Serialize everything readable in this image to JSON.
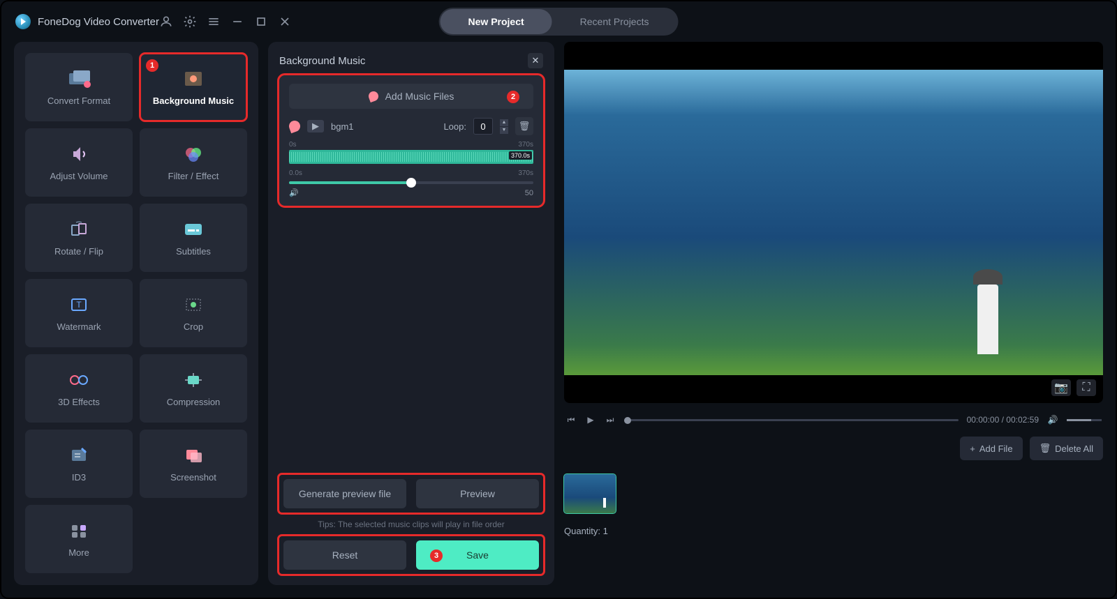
{
  "app": {
    "title": "FoneDog Video Converter"
  },
  "tabs": {
    "new_project": "New Project",
    "recent_projects": "Recent Projects"
  },
  "tools": {
    "convert_format": "Convert Format",
    "background_music": "Background Music",
    "adjust_volume": "Adjust Volume",
    "filter_effect": "Filter / Effect",
    "rotate_flip": "Rotate / Flip",
    "subtitles": "Subtitles",
    "watermark": "Watermark",
    "crop": "Crop",
    "effects_3d": "3D Effects",
    "compression": "Compression",
    "id3": "ID3",
    "screenshot": "Screenshot",
    "more": "More"
  },
  "panel": {
    "title": "Background Music",
    "add_music_label": "Add Music Files",
    "track_name": "bgm1",
    "loop_label": "Loop:",
    "loop_value": "0",
    "wave_start": "0s",
    "wave_end": "370s",
    "wave_tip": "370.0s",
    "vol_start": "0.0s",
    "vol_end": "370s",
    "vol_value": "50",
    "generate_preview": "Generate preview file",
    "preview_btn": "Preview",
    "tips": "Tips: The selected music clips will play in file order",
    "reset": "Reset",
    "save": "Save",
    "badge1": "1",
    "badge2": "2",
    "badge3": "3"
  },
  "playback": {
    "time_display": "00:00:00 / 00:02:59"
  },
  "file_actions": {
    "add_file": "Add File",
    "delete_all": "Delete All"
  },
  "quantity": {
    "label": "Quantity: 1"
  }
}
